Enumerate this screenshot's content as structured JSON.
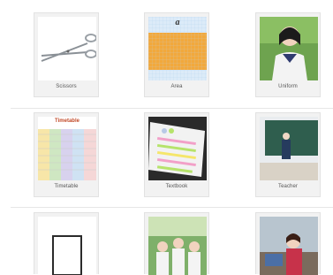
{
  "cards": [
    {
      "label": "Scissors",
      "icon": "scissors-image"
    },
    {
      "label": "Area",
      "icon": "area-grid-image",
      "overlay_text": "a"
    },
    {
      "label": "Uniform",
      "icon": "student-uniform-photo"
    },
    {
      "label": "Timetable",
      "icon": "timetable-image",
      "overlay_text": "Timetable"
    },
    {
      "label": "Textbook",
      "icon": "textbook-highlighter-photo"
    },
    {
      "label": "Teacher",
      "icon": "teacher-chalkboard-photo"
    },
    {
      "label": "",
      "icon": "blank-rectangle-image"
    },
    {
      "label": "",
      "icon": "students-group-photo"
    },
    {
      "label": "",
      "icon": "student-classroom-photo"
    }
  ],
  "colors": {
    "card_bg": "#f2f2f2",
    "area_fill": "#f2a83c",
    "area_grid": "#cfe3f5"
  }
}
